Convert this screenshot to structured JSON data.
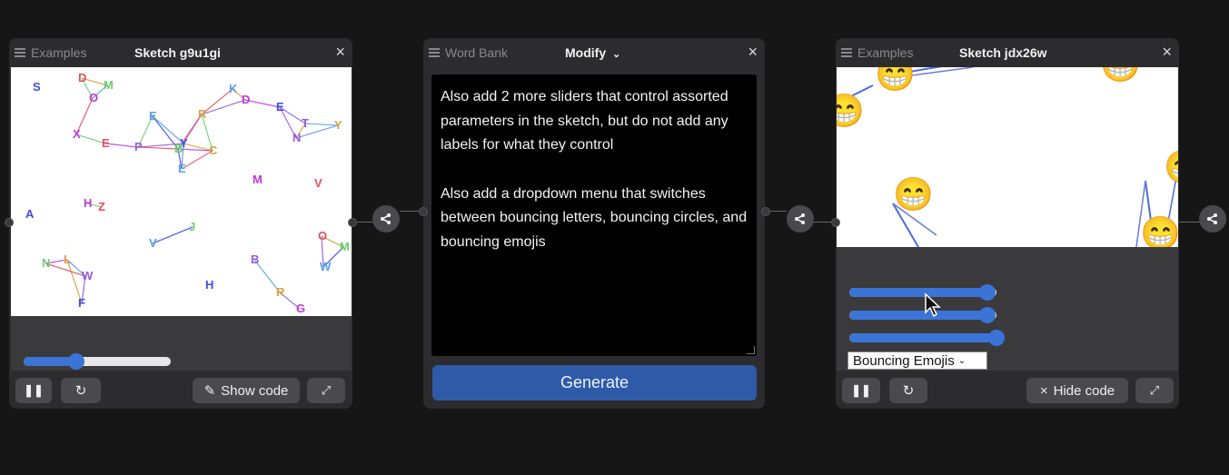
{
  "left_panel": {
    "header_left": "Examples",
    "title": "Sketch g9u1gi",
    "close": "×",
    "show_code_label": "Show code",
    "slider_value_fraction": 0.36
  },
  "middle_panel": {
    "header_left": "Word Bank",
    "title": "Modify",
    "close": "×",
    "prompt_line1": "Also add 2 more sliders that control assorted parameters in the sketch, but do not add any labels for what they control",
    "prompt_line2": "Also add a dropdown menu that switches between bouncing letters, bouncing circles, and bouncing emojis",
    "generate_label": "Generate"
  },
  "right_panel": {
    "header_left": "Examples",
    "title": "Sketch jdx26w",
    "close": "×",
    "hide_code_label": "Hide code",
    "sliders": [
      0.94,
      0.94,
      1.0
    ],
    "dropdown_selected": "Bouncing Emojis"
  },
  "letters": [
    "S",
    "O",
    "D",
    "M",
    "E",
    "R",
    "P",
    "Y",
    "X",
    "E",
    "B",
    "E",
    "C",
    "N",
    "A",
    "H",
    "Z",
    "J",
    "V",
    "L",
    "W",
    "F",
    "M",
    "V",
    "N",
    "W",
    "R",
    "B",
    "H",
    "G",
    "O",
    "M",
    "K",
    "Y",
    "T",
    "E",
    "D"
  ],
  "emoji": "😁",
  "colors": {
    "accent": "#3b74d6",
    "panel_bg": "#2c2c2e",
    "page_bg": "#161616",
    "button_bg": "#4a4a4e"
  }
}
